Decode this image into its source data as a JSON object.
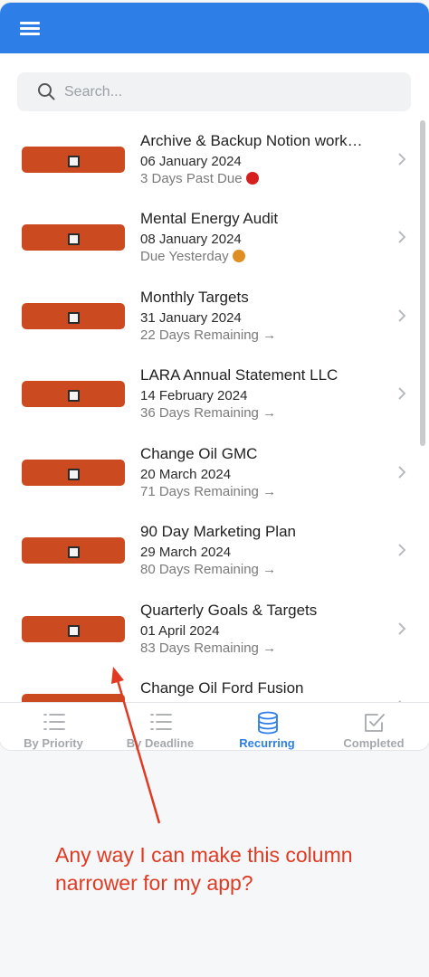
{
  "search": {
    "placeholder": "Search..."
  },
  "tasks": [
    {
      "title": "Archive & Backup Notion work…",
      "date": "06 January 2024",
      "status": "3 Days Past Due",
      "marker": "red-circle",
      "marker_color": "#d61f1f"
    },
    {
      "title": "Mental Energy Audit",
      "date": "08 January 2024",
      "status": "Due Yesterday",
      "marker": "orange-circle",
      "marker_color": "#e08e22"
    },
    {
      "title": "Monthly Targets",
      "date": "31 January 2024",
      "status": "22 Days Remaining →",
      "marker": "none"
    },
    {
      "title": "LARA Annual Statement LLC",
      "date": "14 February 2024",
      "status": "36 Days Remaining →",
      "marker": "none"
    },
    {
      "title": "Change Oil GMC",
      "date": "20 March 2024",
      "status": "71 Days Remaining →",
      "marker": "none"
    },
    {
      "title": "90 Day Marketing Plan",
      "date": "29 March 2024",
      "status": "80 Days Remaining →",
      "marker": "none"
    },
    {
      "title": "Quarterly Goals & Targets",
      "date": "01 April 2024",
      "status": "83 Days Remaining →",
      "marker": "none"
    },
    {
      "title": "Change Oil Ford Fusion",
      "date": "",
      "status": "",
      "marker": "none"
    }
  ],
  "tabs": [
    {
      "label": "By Priority",
      "icon": "list-icon",
      "active": false
    },
    {
      "label": "By Deadline",
      "icon": "list-icon",
      "active": false
    },
    {
      "label": "Recurring",
      "icon": "database-icon",
      "active": true
    },
    {
      "label": "Completed",
      "icon": "checkbox-icon",
      "active": false
    }
  ],
  "annotation": {
    "text": "Any way I can make this column narrower for my app?"
  },
  "colors": {
    "header": "#2e7ee8",
    "badge": "#cc4a20",
    "active_tab": "#2e7ee8",
    "annotation": "#e13a22"
  }
}
